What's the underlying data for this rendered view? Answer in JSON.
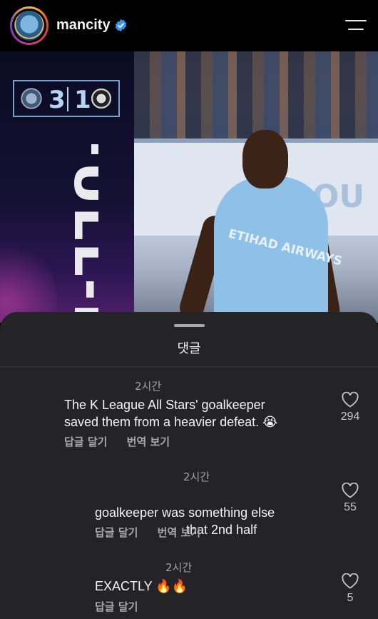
{
  "header": {
    "username": "mancity",
    "verified_icon": "verified-badge-icon",
    "menu_icon": "hamburger-menu-icon"
  },
  "post": {
    "score_home": "3",
    "score_away": "1",
    "banner_text": "FULL-TI",
    "sponsor": "ETIHAD AIRWAYS",
    "board_text": "OU"
  },
  "comments_sheet": {
    "title": "댓글",
    "comments": [
      {
        "time": "2시간",
        "text": "The K League All Stars' goalkeeper\nsaved them from a heavier defeat. 😭",
        "reply_label": "답글 달기",
        "translate_label": "번역 보기",
        "likes": "294"
      },
      {
        "time": "2시간",
        "text": "that 2nd half\ngoalkeeper was something else",
        "reply_label": "답글 달기",
        "translate_label": "번역 보기",
        "likes": "55"
      },
      {
        "time": "2시간",
        "text": "EXACTLY 🔥🔥",
        "reply_label": "답글 달기",
        "likes": "5"
      }
    ]
  },
  "colors": {
    "sheet_bg": "#242427",
    "accent_verified": "#3897f0",
    "score_blue": "#b7d3f2"
  }
}
